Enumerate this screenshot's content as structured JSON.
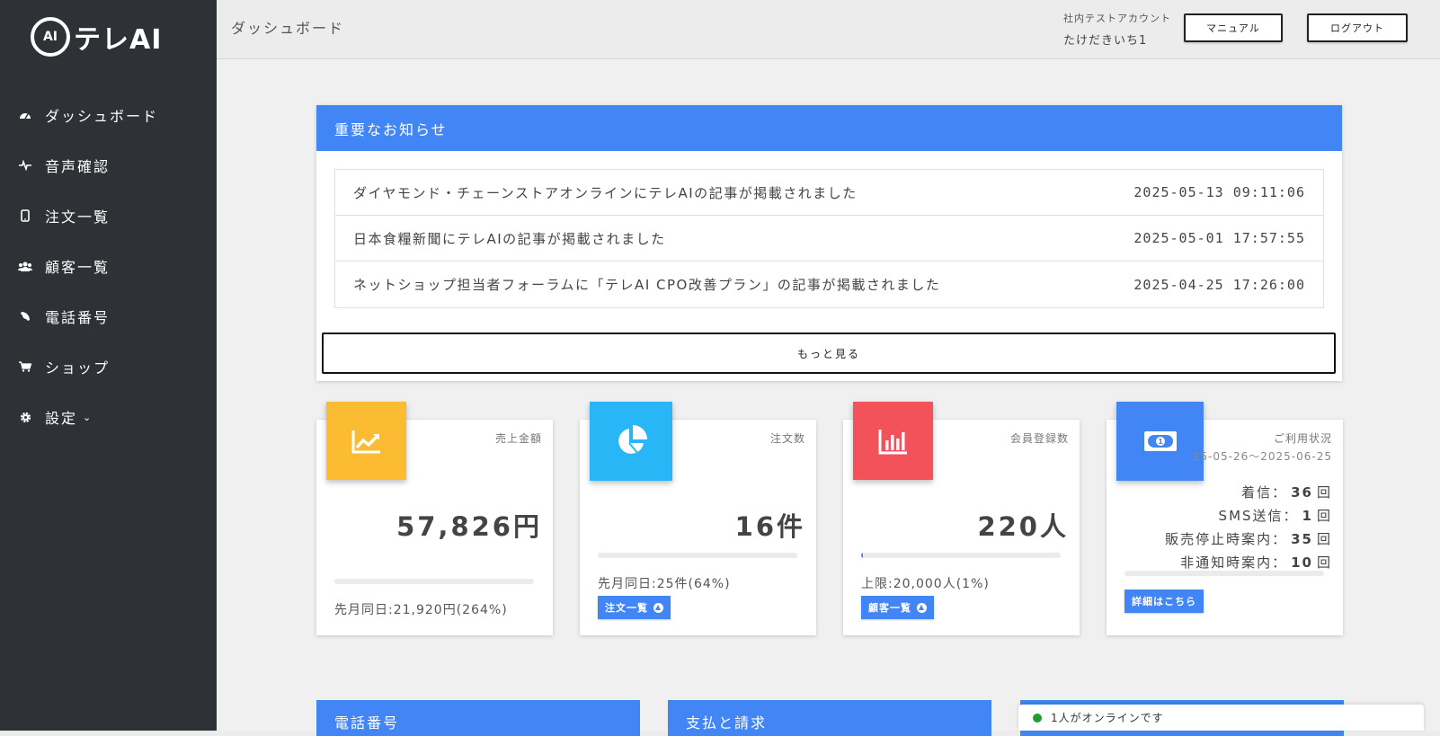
{
  "app": {
    "logo_text": "テレAI",
    "logo_mark": "AI"
  },
  "sidebar": {
    "items": [
      {
        "label": "ダッシュボード",
        "icon": "dashboard-gauge-icon"
      },
      {
        "label": "音声確認",
        "icon": "waveform-icon"
      },
      {
        "label": "注文一覧",
        "icon": "mobile-phone-icon"
      },
      {
        "label": "顧客一覧",
        "icon": "users-icon"
      },
      {
        "label": "電話番号",
        "icon": "phone-icon"
      },
      {
        "label": "ショップ",
        "icon": "cart-icon"
      },
      {
        "label": "設定",
        "icon": "gear-icon"
      }
    ]
  },
  "header": {
    "page_title": "ダッシュボード",
    "account_label": "社内テストアカウント",
    "account_name": "たけだきいち1",
    "manual_label": "マニュアル",
    "logout_label": "ログアウト"
  },
  "notice": {
    "title": "重要なお知らせ",
    "items": [
      {
        "text": "ダイヤモンド・チェーンストアオンラインにテレAIの記事が掲載されました",
        "date": "2025-05-13 09:11:06"
      },
      {
        "text": "日本食糧新聞にテレAIの記事が掲載されました",
        "date": "2025-05-01 17:57:55"
      },
      {
        "text": "ネットショップ担当者フォーラムに「テレAI CPO改善プラン」の記事が掲載されました",
        "date": "2025-04-25 17:26:00"
      }
    ],
    "more_label": "もっと見る"
  },
  "stats": {
    "sales": {
      "label": "売上金額",
      "value": "57,826円",
      "progress": 0,
      "sub": "先月同日:21,920円(264%)",
      "color": "#fbbc34"
    },
    "orders": {
      "label": "注文数",
      "value": "16件",
      "progress": 0,
      "sub": "先月同日:25件(64%)",
      "button": "注文一覧",
      "color": "#29b6f6"
    },
    "members": {
      "label": "会員登録数",
      "value": "220人",
      "progress": 0.01,
      "sub": "上限:20,000人(1%)",
      "button": "顧客一覧",
      "color": "#f4525a"
    },
    "usage": {
      "label": "ご利用状況",
      "period": "25-05-26〜2025-06-25",
      "rows": [
        {
          "label": "着信：",
          "value": "36",
          "unit": "回"
        },
        {
          "label": "SMS送信：",
          "value": "1",
          "unit": "回"
        },
        {
          "label": "販売停止時案内：",
          "value": "35",
          "unit": "回"
        },
        {
          "label": "非通知時案内：",
          "value": "10",
          "unit": "回"
        }
      ],
      "button": "詳細はこちら",
      "color": "#4285f4"
    }
  },
  "bottom_cards": [
    "電話番号",
    "支払と請求",
    ""
  ],
  "online": {
    "text": "1人がオンラインです",
    "color": "#1e9e2e"
  },
  "colors": {
    "accent": "#4285f4",
    "sidebar": "#2e3136"
  }
}
